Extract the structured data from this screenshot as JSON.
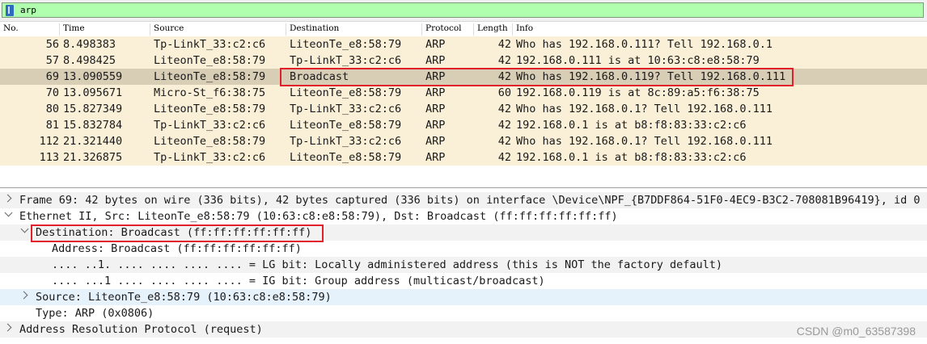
{
  "filter": {
    "text": "arp"
  },
  "columns": [
    "No.",
    "Time",
    "Source",
    "Destination",
    "Protocol",
    "Length",
    "Info"
  ],
  "packets": [
    {
      "no": "56",
      "time": "8.498383",
      "src": "Tp-LinkT_33:c2:c6",
      "dst": "LiteonTe_e8:58:79",
      "proto": "ARP",
      "len": "42",
      "info": "Who has 192.168.0.111? Tell 192.168.0.1"
    },
    {
      "no": "57",
      "time": "8.498425",
      "src": "LiteonTe_e8:58:79",
      "dst": "Tp-LinkT_33:c2:c6",
      "proto": "ARP",
      "len": "42",
      "info": "192.168.0.111 is at 10:63:c8:e8:58:79"
    },
    {
      "no": "69",
      "time": "13.090559",
      "src": "LiteonTe_e8:58:79",
      "dst": "Broadcast",
      "proto": "ARP",
      "len": "42",
      "info": "Who has 192.168.0.119? Tell 192.168.0.111"
    },
    {
      "no": "70",
      "time": "13.095671",
      "src": "Micro-St_f6:38:75",
      "dst": "LiteonTe_e8:58:79",
      "proto": "ARP",
      "len": "60",
      "info": "192.168.0.119 is at 8c:89:a5:f6:38:75"
    },
    {
      "no": "80",
      "time": "15.827349",
      "src": "LiteonTe_e8:58:79",
      "dst": "Tp-LinkT_33:c2:c6",
      "proto": "ARP",
      "len": "42",
      "info": "Who has 192.168.0.1? Tell 192.168.0.111"
    },
    {
      "no": "81",
      "time": "15.832784",
      "src": "Tp-LinkT_33:c2:c6",
      "dst": "LiteonTe_e8:58:79",
      "proto": "ARP",
      "len": "42",
      "info": "192.168.0.1 is at b8:f8:83:33:c2:c6"
    },
    {
      "no": "112",
      "time": "21.321440",
      "src": "LiteonTe_e8:58:79",
      "dst": "Tp-LinkT_33:c2:c6",
      "proto": "ARP",
      "len": "42",
      "info": "Who has 192.168.0.1? Tell 192.168.0.111"
    },
    {
      "no": "113",
      "time": "21.326875",
      "src": "Tp-LinkT_33:c2:c6",
      "dst": "LiteonTe_e8:58:79",
      "proto": "ARP",
      "len": "42",
      "info": "192.168.0.1 is at b8:f8:83:33:c2:c6"
    }
  ],
  "details": [
    {
      "text": "Frame 69: 42 bytes on wire (336 bits), 42 bytes captured (336 bits) on interface \\Device\\NPF_{B7DDF864-51F0-4EC9-B3C2-708081B96419}, id 0"
    },
    {
      "text": "Ethernet II, Src: LiteonTe_e8:58:79 (10:63:c8:e8:58:79), Dst: Broadcast (ff:ff:ff:ff:ff:ff)"
    },
    {
      "text": "Destination: Broadcast (ff:ff:ff:ff:ff:ff)"
    },
    {
      "text": "Address: Broadcast (ff:ff:ff:ff:ff:ff)"
    },
    {
      "text": ".... ..1. .... .... .... .... = LG bit: Locally administered address (this is NOT the factory default)"
    },
    {
      "text": ".... ...1 .... .... .... .... = IG bit: Group address (multicast/broadcast)"
    },
    {
      "text": "Source: LiteonTe_e8:58:79 (10:63:c8:e8:58:79)"
    },
    {
      "text": "Type: ARP (0x0806)"
    },
    {
      "text": "Address Resolution Protocol (request)"
    }
  ],
  "watermark": "CSDN @m0_63587398"
}
